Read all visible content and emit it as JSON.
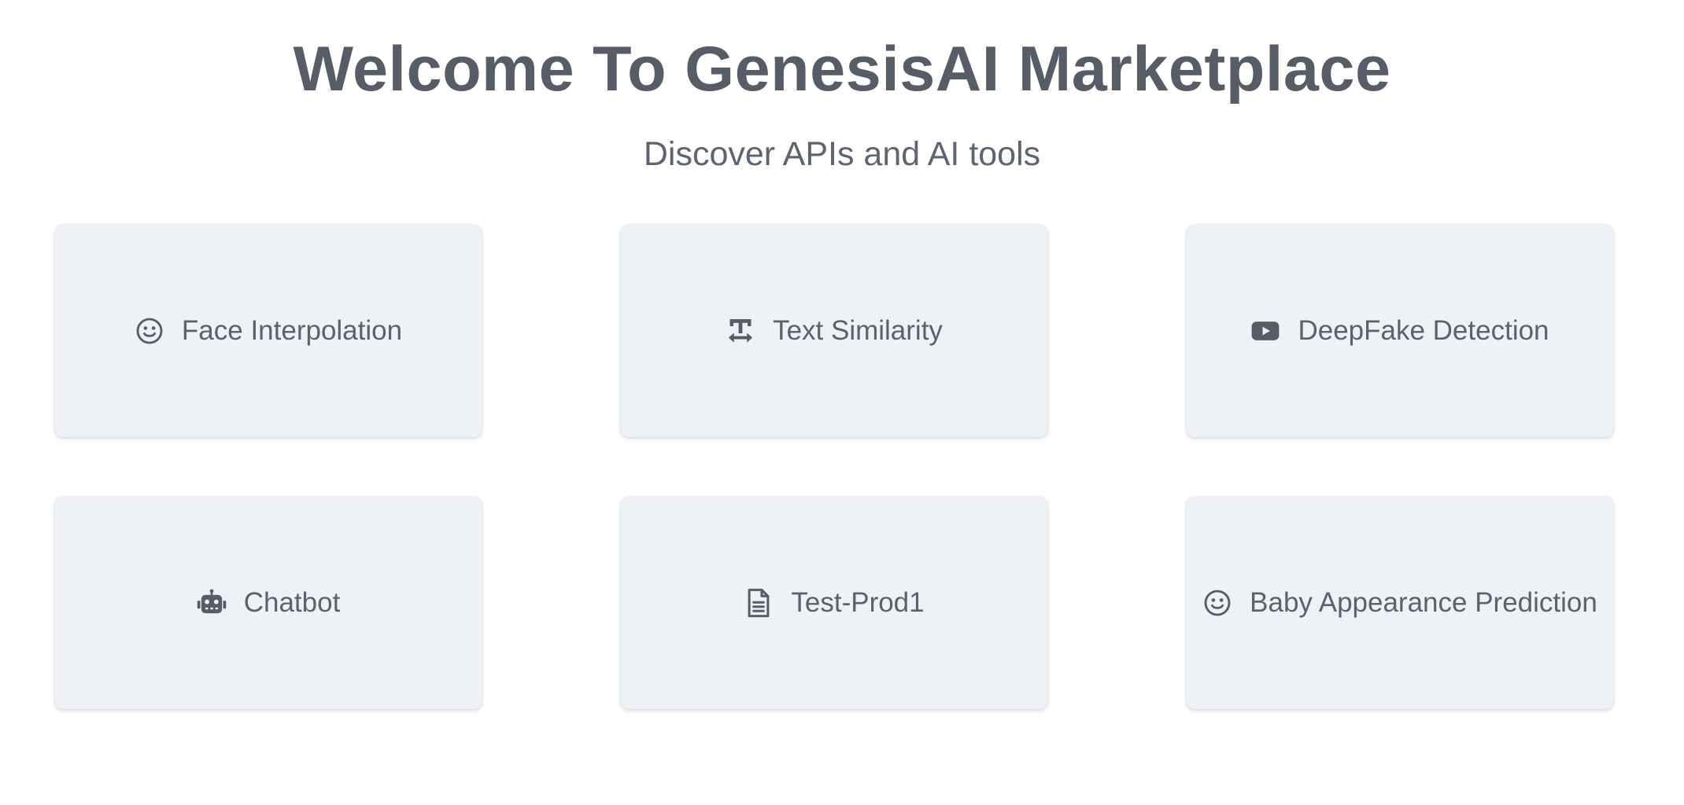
{
  "header": {
    "title": "Welcome To GenesisAI Marketplace",
    "subtitle": "Discover APIs and AI tools"
  },
  "cards": [
    {
      "label": "Face Interpolation",
      "icon": "smile-icon"
    },
    {
      "label": "Text Similarity",
      "icon": "text-height-icon"
    },
    {
      "label": "DeepFake Detection",
      "icon": "youtube-icon"
    },
    {
      "label": "Chatbot",
      "icon": "robot-icon"
    },
    {
      "label": "Test-Prod1",
      "icon": "file-text-icon"
    },
    {
      "label": "Baby Appearance Prediction",
      "icon": "smile-icon"
    }
  ],
  "colors": {
    "text": "#565d67",
    "card_background": "#eef1f6",
    "page_background": "#ffffff"
  }
}
